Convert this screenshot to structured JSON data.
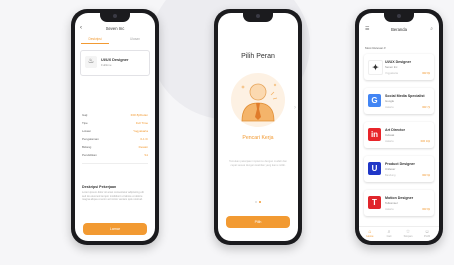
{
  "phone_detail": {
    "header_title": "Seven Inc",
    "back_icon": "arrow-left",
    "tabs": [
      {
        "label": "Deskripsi"
      },
      {
        "label": "Ulasan"
      }
    ],
    "job": {
      "title": "UI/UX Designer",
      "subtitle": "Fulltime",
      "logo_icon": "flame-logo"
    },
    "details": [
      {
        "label": "Gaji",
        "value": "IDR 8jt/bulan"
      },
      {
        "label": "Tipe",
        "value": "Full Time"
      },
      {
        "label": "Lokasi",
        "value": "Yogyakarta"
      },
      {
        "label": "Pengalaman",
        "value": "0-1 th"
      },
      {
        "label": "Bidang",
        "value": "Desain"
      },
      {
        "label": "Pendidikan",
        "value": "S1"
      }
    ],
    "description_title": "Deskripsi Pekerjaan",
    "description_text": "Lorem ipsum dolor sit amet consectetur adipiscing elit sed do eiusmod tempor incididunt ut labore et dolore magna aliqua ut enim ad minim veniam quis nostrud.",
    "button_label": "Lamar"
  },
  "phone_role": {
    "title": "Pilih Peran",
    "illustration_icon": "worker-with-tie-icon",
    "subtitle": "Pencari Kerja",
    "body_text": "Temukan pekerjaan impianmu dengan mudah dan cepat sesuai dengan keahlian yang kamu miliki.",
    "pager_count": 2,
    "pager_active": 1,
    "button_label": "Pilih"
  },
  "phone_home": {
    "title": "Beranda",
    "menu_icon": "hamburger-menu",
    "search_icon": "search",
    "filter_label": "Most Relevan",
    "jobs": [
      {
        "title": "UI/UX Designer",
        "company": "Seven Inc",
        "meta": "Yogyakarta",
        "salary": "IDR 8jt",
        "logo_color": "#ffffff",
        "logo_text": "✦",
        "logo_text_color": "#333333"
      },
      {
        "title": "Social Media Specialist",
        "company": "Google",
        "meta": "Jakarta",
        "salary": "IDR 7jt",
        "logo_color": "#4285f4",
        "logo_text": "G",
        "logo_text_color": "#ffffff"
      },
      {
        "title": "Art Director",
        "company": "Indosat",
        "meta": "Jakarta",
        "salary": "IDR 10jt",
        "logo_color": "#e8252a",
        "logo_text": "in",
        "logo_text_color": "#ffffff"
      },
      {
        "title": "Product Designer",
        "company": "Unilever",
        "meta": "Bandung",
        "salary": "IDR 9jt",
        "logo_color": "#1f36c7",
        "logo_text": "U",
        "logo_text_color": "#ffffff"
      },
      {
        "title": "Motion Designer",
        "company": "Telkomsel",
        "meta": "Jakarta",
        "salary": "IDR 8jt",
        "logo_color": "#e0252b",
        "logo_text": "T",
        "logo_text_color": "#ffffff"
      }
    ],
    "nav": [
      {
        "label": "Home",
        "icon": "⌂",
        "active": true
      },
      {
        "label": "Cari",
        "icon": "⌕",
        "active": false
      },
      {
        "label": "Simpan",
        "icon": "☆",
        "active": false
      },
      {
        "label": "Profil",
        "icon": "☺",
        "active": false
      }
    ]
  },
  "colors": {
    "accent": "#f29a32",
    "background": "#f6f6f8",
    "phone_frame": "#1b1b1e"
  }
}
